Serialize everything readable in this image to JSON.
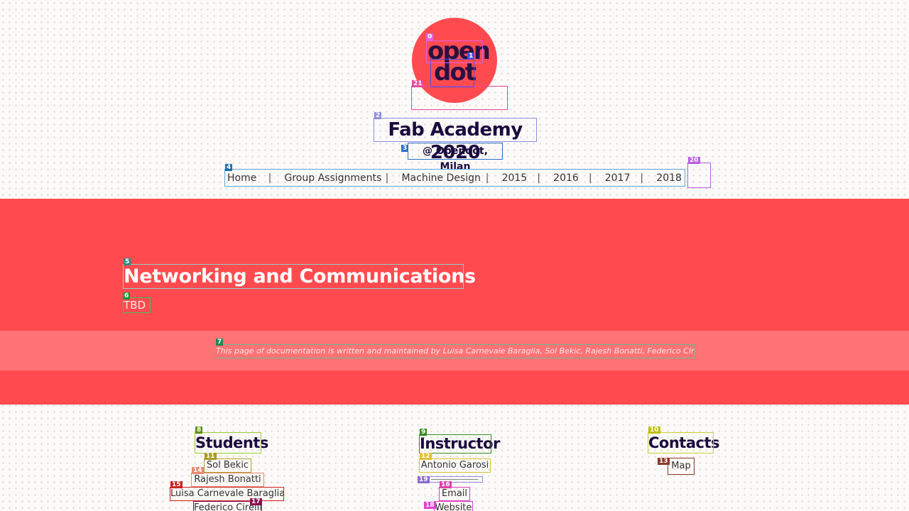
{
  "logo": {
    "line1": "open",
    "line2": "dot"
  },
  "header": {
    "title": "Fab Academy 2020",
    "subtitle": "@ Opendot, Milan"
  },
  "nav": {
    "items": [
      "Home",
      "Group Assignments",
      "Machine Design",
      "2015",
      "2016",
      "2017",
      "2018"
    ],
    "separator": "|"
  },
  "page": {
    "title": "Networking and Communications",
    "subtitle": "TBD",
    "note": "This page of documentation is written and maintained by Luisa Carnevale Baraglia, Sol Bekic, Rajesh Bonatti, Federico Cirelli."
  },
  "footer": {
    "students": {
      "heading": "Students",
      "items": [
        "Sol Bekic",
        "Rajesh Bonatti",
        "Luisa Carnevale Baraglia",
        "Federico Cirelli"
      ]
    },
    "instructor": {
      "heading": "Instructor",
      "name": "Antonio Garosi",
      "links": [
        "Email",
        "Website"
      ]
    },
    "contacts": {
      "heading": "Contacts",
      "items": [
        "Map"
      ]
    }
  },
  "annotation_labels": [
    "0",
    "1",
    "2",
    "3",
    "4",
    "5",
    "6",
    "7",
    "8",
    "9",
    "10",
    "11",
    "12",
    "13",
    "14",
    "15",
    "16",
    "17",
    "18",
    "19",
    "20",
    "21"
  ],
  "colors": {
    "accent_red": "#ff4b4f",
    "ink": "#1b0a3e"
  }
}
